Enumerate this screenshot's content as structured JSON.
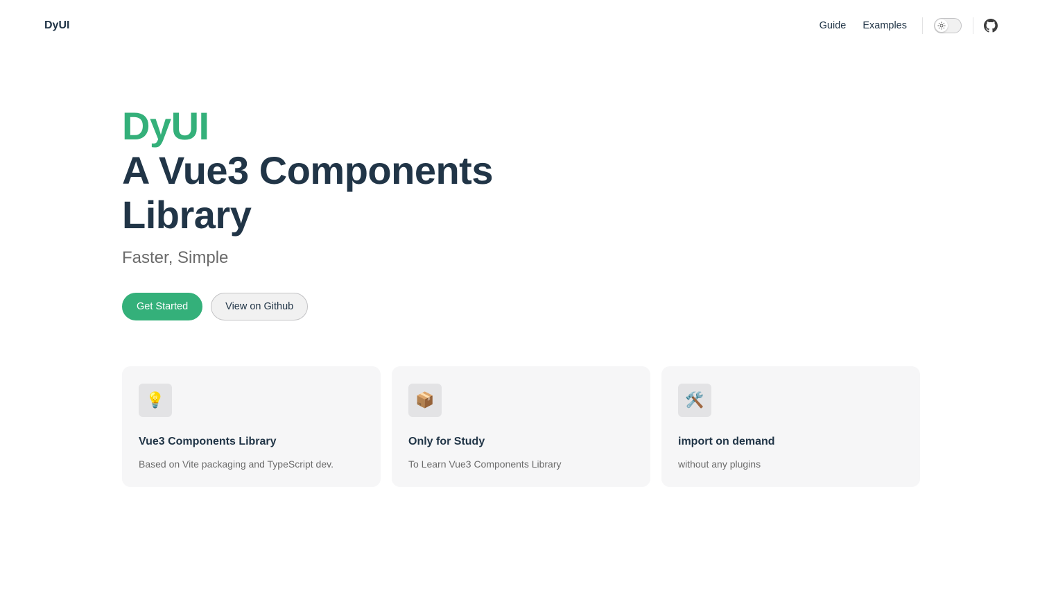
{
  "nav": {
    "brand": "DyUI",
    "links": [
      "Guide",
      "Examples"
    ],
    "theme_toggle_icon": "sun-icon",
    "github_icon": "github-icon"
  },
  "hero": {
    "name": "DyUI",
    "text_line1": "A Vue3 Components",
    "text_line2": "Library",
    "tagline": "Faster, Simple",
    "actions": {
      "primary": "Get Started",
      "alt": "View on Github"
    }
  },
  "features": [
    {
      "icon": "💡",
      "icon_name": "lightbulb-icon",
      "title": "Vue3 Components Library",
      "details": "Based on Vite packaging and TypeScript dev."
    },
    {
      "icon": "📦",
      "icon_name": "package-icon",
      "title": "Only for Study",
      "details": "To Learn Vue3 Components Library"
    },
    {
      "icon": "🛠️",
      "icon_name": "tools-icon",
      "title": "import on demand",
      "details": "without any plugins"
    }
  ],
  "colors": {
    "brand": "#34b07a",
    "text": "#213547",
    "muted": "#6b6b6b",
    "card_bg": "#f6f6f7"
  }
}
